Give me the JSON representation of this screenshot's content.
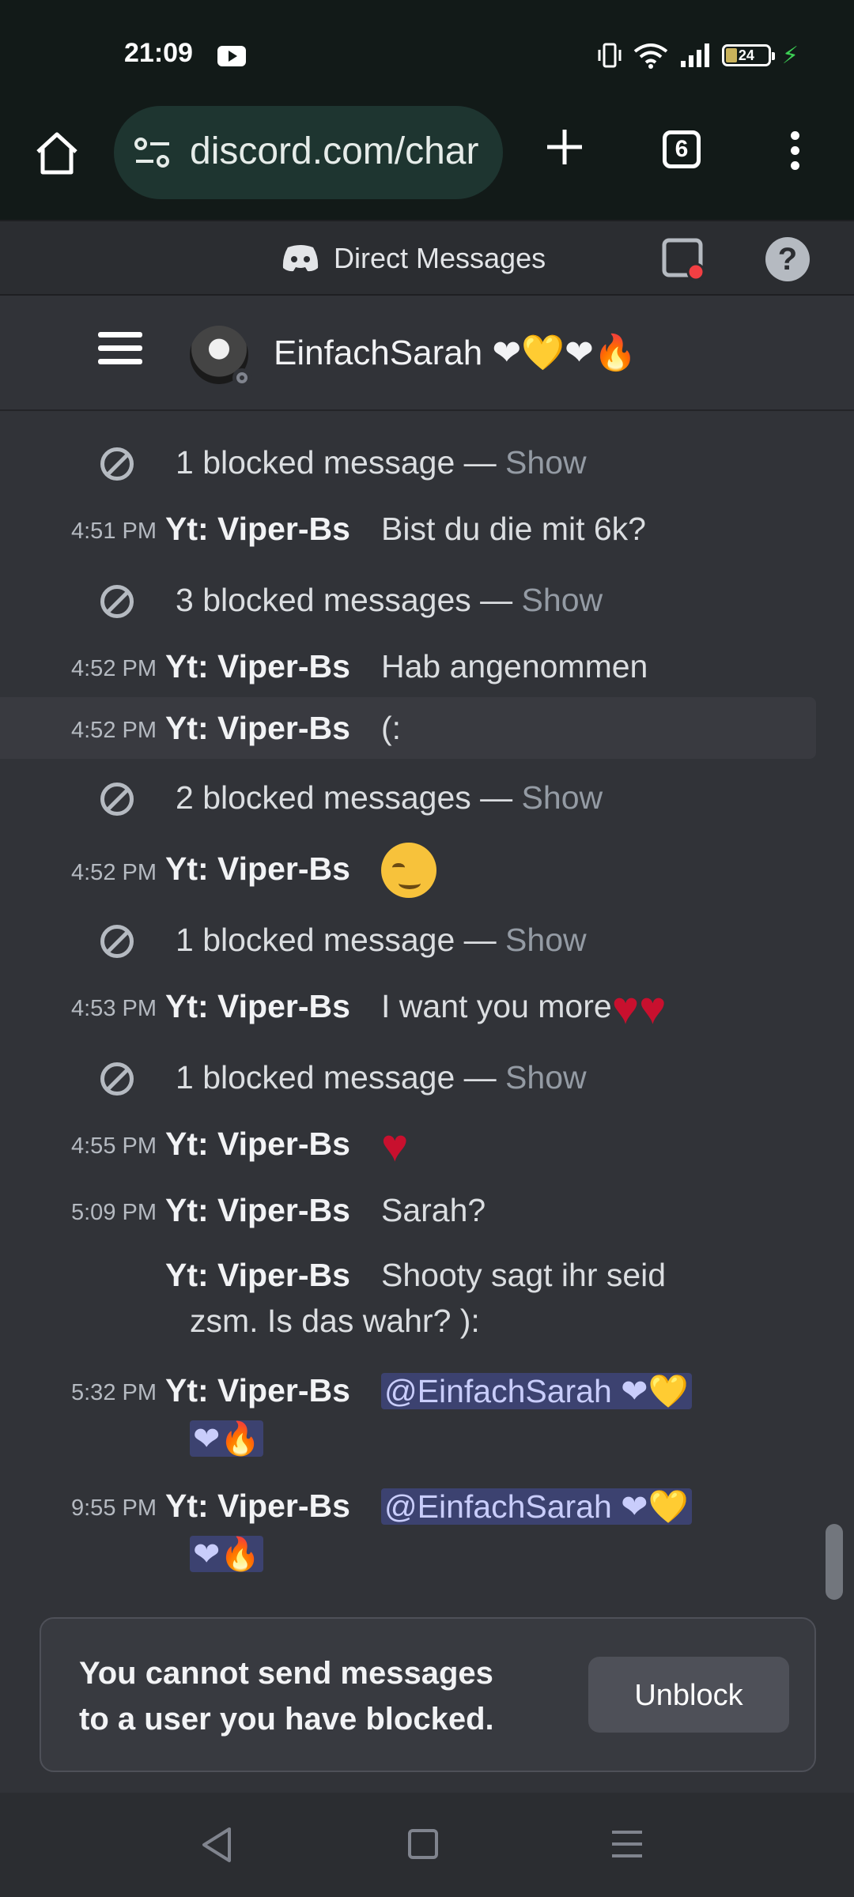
{
  "status_bar": {
    "time": "21:09",
    "battery": "24"
  },
  "browser": {
    "url": "discord.com/char",
    "tab_count": "6"
  },
  "header": {
    "title": "Direct Messages"
  },
  "channel": {
    "name": "EinfachSarah ❤💛❤🔥"
  },
  "messages": [
    {
      "type": "blocked",
      "text": "1 blocked message — ",
      "action": "Show"
    },
    {
      "type": "msg",
      "time": "4:51 PM",
      "author": "Yt: Viper-Bs",
      "text": "Bist du die mit 6k?"
    },
    {
      "type": "blocked",
      "text": "3 blocked messages — ",
      "action": "Show"
    },
    {
      "type": "msg",
      "time": "4:52 PM",
      "author": "Yt: Viper-Bs",
      "text": "Hab angenommen"
    },
    {
      "type": "msg",
      "time": "4:52 PM",
      "author": "Yt: Viper-Bs",
      "text": "(:"
    },
    {
      "type": "blocked",
      "text": "2 blocked messages — ",
      "action": "Show"
    },
    {
      "type": "msg",
      "time": "4:52 PM",
      "author": "Yt: Viper-Bs",
      "text": ""
    },
    {
      "type": "blocked",
      "text": "1 blocked message — ",
      "action": "Show"
    },
    {
      "type": "msg",
      "time": "4:53 PM",
      "author": "Yt: Viper-Bs",
      "text": "I want you more"
    },
    {
      "type": "blocked",
      "text": "1 blocked message — ",
      "action": "Show"
    },
    {
      "type": "msg",
      "time": "4:55 PM",
      "author": "Yt: Viper-Bs",
      "text": ""
    },
    {
      "type": "msg",
      "time": "5:09 PM",
      "author": "Yt: Viper-Bs",
      "text": "Sarah?"
    },
    {
      "type": "msg",
      "time": "",
      "author": "Yt: Viper-Bs",
      "text": "Shooty sagt ihr seid",
      "text2": "zsm. Is das wahr? ):"
    },
    {
      "type": "msg",
      "time": "5:32 PM",
      "author": "Yt: Viper-Bs",
      "mention": "@EinfachSarah ❤💛",
      "mention2": "❤🔥"
    },
    {
      "type": "msg",
      "time": "9:55 PM",
      "author": "Yt: Viper-Bs",
      "mention": "@EinfachSarah ❤💛",
      "mention2": "❤🔥"
    }
  ],
  "footer": {
    "blocked_line1": "You cannot send messages",
    "blocked_line2": "to a user you have blocked.",
    "unblock_label": "Unblock"
  },
  "icons": {
    "home": "home-icon",
    "tune": "site-settings-icon",
    "plus": "new-tab-icon",
    "tabs": "tab-switcher-icon",
    "menu": "overflow-menu-icon",
    "discord": "discord-logo-icon",
    "inbox": "inbox-icon",
    "help": "help-icon",
    "blocked": "blocked-icon",
    "heart": "red-heart-emoji",
    "smirk": "smirking-face-emoji"
  }
}
